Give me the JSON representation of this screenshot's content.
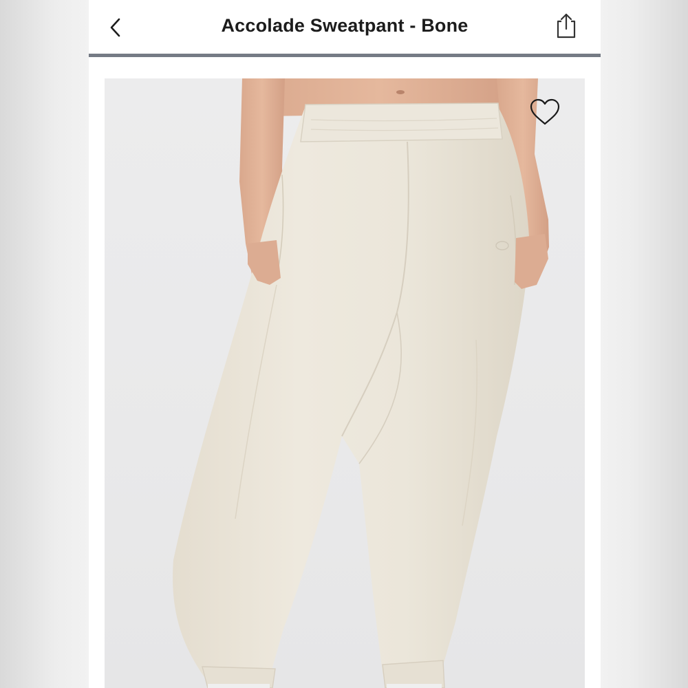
{
  "header": {
    "title": "Accolade Sweatpant - Bone",
    "back_icon": "chevron-left-icon",
    "share_icon": "share-icon"
  },
  "product": {
    "image_subject": "sweatpant-photo",
    "favorite_icon": "heart-outline-icon"
  },
  "colors": {
    "divider": "#757b85",
    "garment": "#ebe6da",
    "image_background": "#e9e9ea",
    "text": "#1c1c1c"
  }
}
